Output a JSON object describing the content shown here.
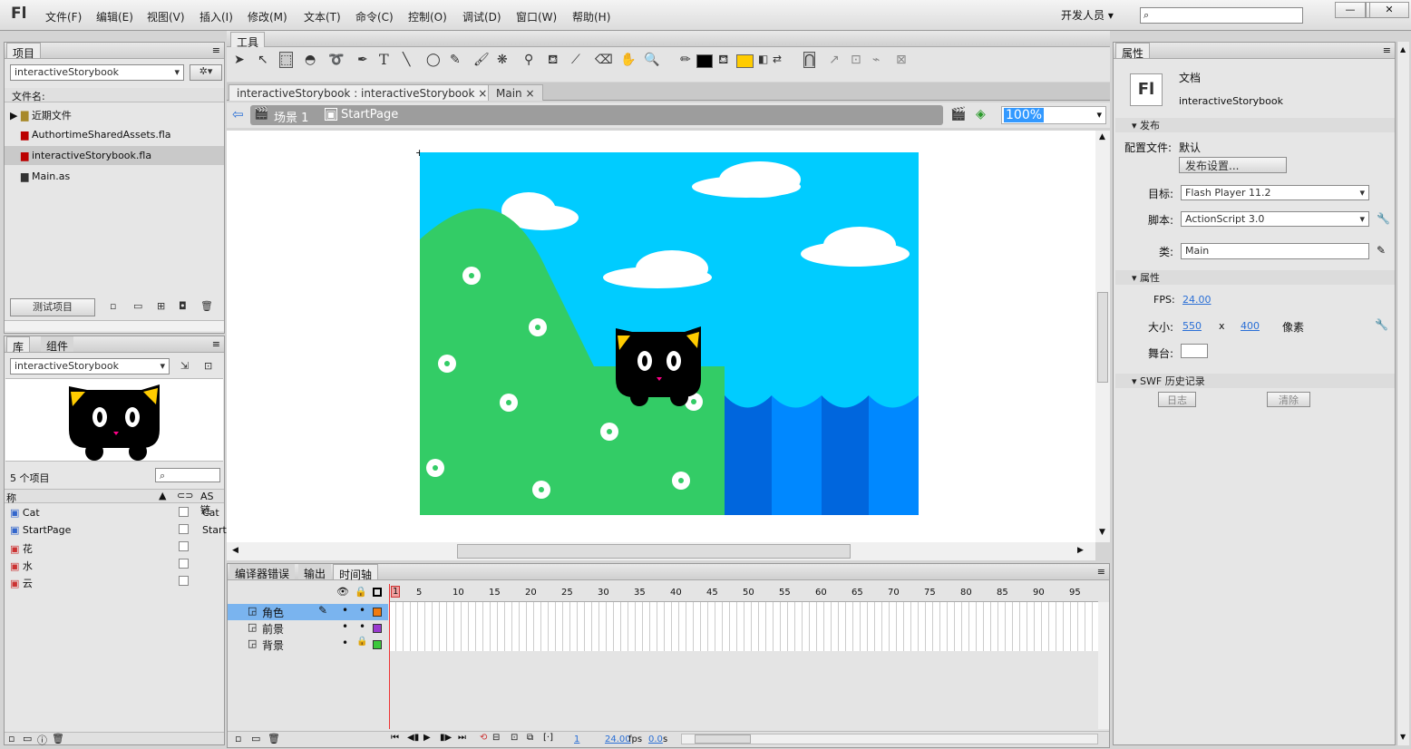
{
  "app": {
    "logo": "Fl"
  },
  "menu": [
    "文件(F)",
    "编辑(E)",
    "视图(V)",
    "插入(I)",
    "修改(M)",
    "文本(T)",
    "命令(C)",
    "控制(O)",
    "调试(D)",
    "窗口(W)",
    "帮助(H)"
  ],
  "workspace": "开发人员",
  "window_controls": [
    "—",
    "□",
    "✕"
  ],
  "project_panel": {
    "tab": "项目",
    "project_select": "interactiveStorybook",
    "filename_label": "文件名:",
    "items": [
      "近期文件",
      "AuthortimeSharedAssets.fla",
      "interactiveStorybook.fla",
      "Main.as"
    ],
    "test_button": "测试项目"
  },
  "library_panel": {
    "tabs": [
      "库",
      "组件"
    ],
    "select": "interactiveStorybook",
    "count": "5 个项目",
    "col_name": "称",
    "col_linkage": "AS 链",
    "items": [
      {
        "name": "Cat",
        "linkage": "Cat"
      },
      {
        "name": "StartPage",
        "linkage": "Start"
      },
      {
        "name": "花",
        "linkage": ""
      },
      {
        "name": "水",
        "linkage": ""
      },
      {
        "name": "云",
        "linkage": ""
      }
    ]
  },
  "tools_panel": {
    "tab": "工具"
  },
  "doc_tabs": [
    "interactiveStorybook : interactiveStorybook",
    "Main"
  ],
  "breadcrumb": {
    "scene": "场景 1",
    "symbol": "StartPage"
  },
  "zoom": "100%",
  "timeline": {
    "tabs": [
      "编译器错误",
      "输出",
      "时间轴"
    ],
    "frame_numbers": [
      "1",
      "5",
      "10",
      "15",
      "20",
      "25",
      "30",
      "35",
      "40",
      "45",
      "50",
      "55",
      "60",
      "65",
      "70",
      "75",
      "80",
      "85",
      "90",
      "95"
    ],
    "layers": [
      {
        "name": "角色",
        "color": "#f07a10"
      },
      {
        "name": "前景",
        "color": "#9a3ad0"
      },
      {
        "name": "背景",
        "color": "#3cc83c"
      }
    ],
    "status": {
      "frame": "1",
      "fps": "24.00",
      "fps_unit": "fps",
      "time": "0.0",
      "time_unit": "s"
    }
  },
  "properties": {
    "tab": "属性",
    "doc_type": "文档",
    "doc_name": "interactiveStorybook",
    "sec_publish": "发布",
    "profile_label": "配置文件:",
    "profile_value": "默认",
    "publish_settings": "发布设置...",
    "target_label": "目标:",
    "target_value": "Flash Player 11.2",
    "script_label": "脚本:",
    "script_value": "ActionScript 3.0",
    "class_label": "类:",
    "class_value": "Main",
    "sec_props": "属性",
    "fps_label": "FPS:",
    "fps_value": "24.00",
    "size_label": "大小:",
    "width": "550",
    "x": "x",
    "height": "400",
    "unit": "像素",
    "stage_label": "舞台:",
    "sec_swf": "SWF 历史记录",
    "log_btn": "日志",
    "clear_btn": "清除"
  },
  "colors": {
    "sky": "#00ccff",
    "hill": "#33cc66",
    "water": "#0088ff",
    "water_dark": "#0066dd",
    "cat": "#000000",
    "ear": "#ffcc00",
    "fill_swatch": "#ffcc00",
    "stroke_swatch": "#000000"
  }
}
